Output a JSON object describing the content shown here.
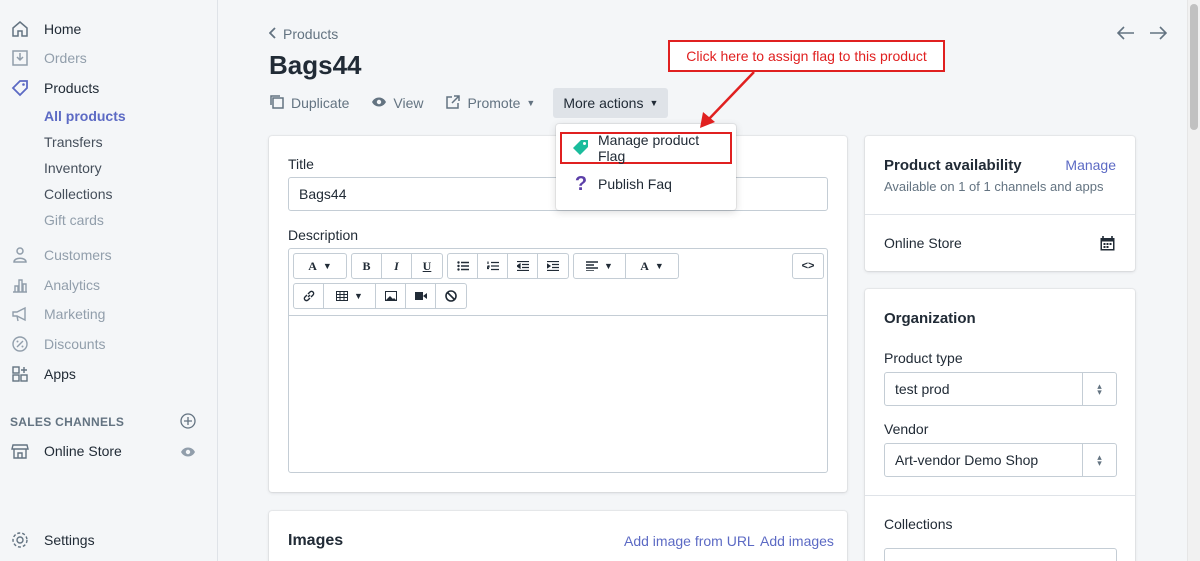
{
  "sidebar": {
    "items": [
      {
        "label": "Home",
        "icon": "home-icon",
        "dim": false
      },
      {
        "label": "Orders",
        "icon": "orders-icon",
        "dim": true
      },
      {
        "label": "Products",
        "icon": "tag-icon",
        "dim": false
      }
    ],
    "sub_items": [
      "All products",
      "Transfers",
      "Inventory",
      "Collections",
      "Gift cards"
    ],
    "more_items": [
      {
        "label": "Customers",
        "icon": "customers-icon"
      },
      {
        "label": "Analytics",
        "icon": "analytics-icon"
      },
      {
        "label": "Marketing",
        "icon": "marketing-icon"
      },
      {
        "label": "Discounts",
        "icon": "discounts-icon"
      },
      {
        "label": "Apps",
        "icon": "apps-icon"
      }
    ],
    "sales_channels_heading": "SALES CHANNELS",
    "online_store": "Online Store",
    "settings": "Settings"
  },
  "breadcrumb": "Products",
  "page_title": "Bags44",
  "actions": {
    "duplicate": "Duplicate",
    "view": "View",
    "promote": "Promote",
    "more": "More actions"
  },
  "dropdown": {
    "items": [
      "Manage product Flag",
      "Publish Faq"
    ]
  },
  "callout": "Click here to assign flag to this product",
  "form": {
    "title_label": "Title",
    "title_value": "Bags44",
    "description_label": "Description",
    "images_heading": "Images",
    "add_from_url": "Add image from URL",
    "add_images": "Add images"
  },
  "availability": {
    "heading": "Product availability",
    "manage": "Manage",
    "subtitle": "Available on 1 of 1 channels and apps",
    "channel": "Online Store"
  },
  "organization": {
    "heading": "Organization",
    "product_type_label": "Product type",
    "product_type_value": "test prod",
    "vendor_label": "Vendor",
    "vendor_value": "Art-vendor Demo Shop",
    "collections_label": "Collections"
  },
  "colors": {
    "accent": "#5c6ac4",
    "annotation": "#e02020",
    "flag_icon": "#1abc9c",
    "faq_icon": "#5c3fa8"
  }
}
